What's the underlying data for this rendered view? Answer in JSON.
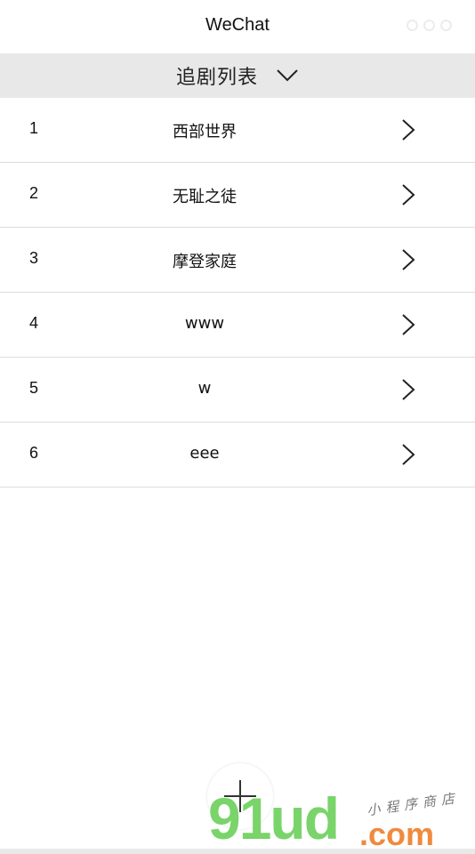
{
  "navbar": {
    "title": "WeChat"
  },
  "header": {
    "title": "追剧列表",
    "icon": "chevron-down-icon"
  },
  "list": {
    "items": [
      {
        "index": "1",
        "title": "西部世界"
      },
      {
        "index": "2",
        "title": "无耻之徒"
      },
      {
        "index": "3",
        "title": "摩登家庭"
      },
      {
        "index": "4",
        "title": "www"
      },
      {
        "index": "5",
        "title": "w"
      },
      {
        "index": "6",
        "title": "eee"
      }
    ],
    "row_icon": "chevron-right-icon"
  },
  "fab": {
    "icon": "plus-icon"
  },
  "watermark": {
    "logo": "91ud",
    "sub": "小程序商店",
    "domain": ".com"
  },
  "colors": {
    "header_bg": "#e8e8e8",
    "divider": "#dcdcdc",
    "watermark_green": "#79d46a",
    "watermark_orange": "#f08a3c"
  }
}
